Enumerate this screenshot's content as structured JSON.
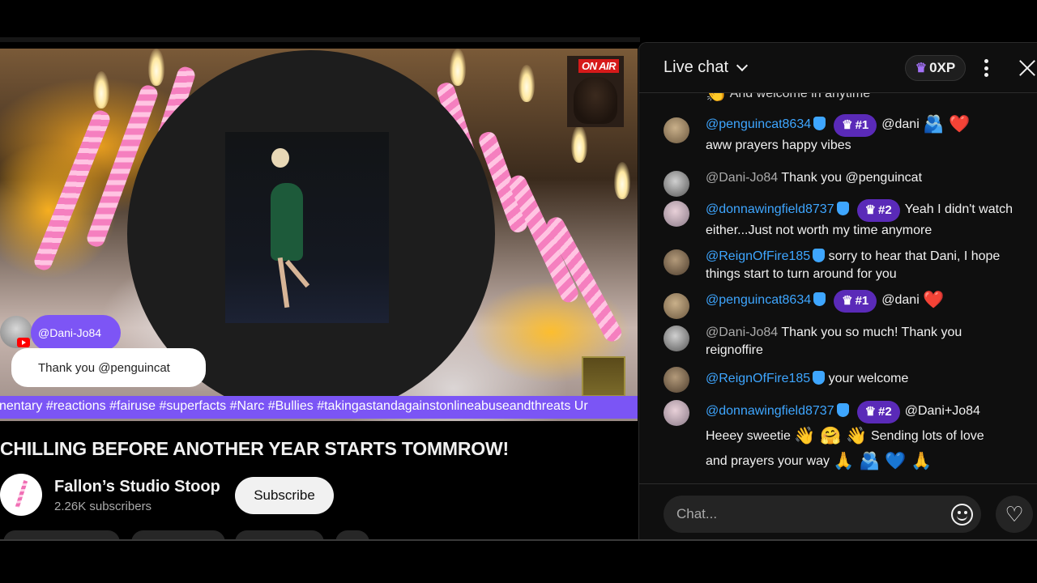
{
  "video": {
    "on_air_label": "ON AIR",
    "overlay_username": "@Dani-Jo84",
    "overlay_message": "Thank you @penguincat",
    "ticker_text": "nentary #reactions #fairuse #superfacts #Narc #Bullies #takingastandagainstonlineabuseandthreats Ur"
  },
  "page": {
    "title": "CHILLING BEFORE ANOTHER YEAR STARTS TOMMROW!"
  },
  "channel": {
    "name": "Fallon’s Studio Stoop",
    "subscribers": "2.26K subscribers",
    "subscribe_label": "Subscribe"
  },
  "chat": {
    "title": "Live chat",
    "xp_label": "0XP",
    "input_placeholder": "Chat...",
    "partial_top": "And welcome in anytime",
    "messages": [
      {
        "author": "@penguincat8634",
        "rank": "#1",
        "text": "@dani",
        "emoji_after": "🫂 ❤️",
        "text2": "aww prayers happy vibes"
      },
      {
        "author": "@Dani-Jo84",
        "text": "Thank you @penguincat"
      },
      {
        "author": "@donnawingfield8737",
        "rank": "#2",
        "text": "Yeah I didn't watch either...Just not worth my time anymore"
      },
      {
        "author": "@ReignOfFire185",
        "text": "sorry to hear that Dani, I hope things start to turn around for you"
      },
      {
        "author": "@penguincat8634",
        "rank": "#1",
        "text": "@dani",
        "emoji_after": "❤️"
      },
      {
        "author": "@Dani-Jo84",
        "text": "Thank you so much! Thank you reignoffire"
      },
      {
        "author": "@ReignOfFire185",
        "text": "your welcome"
      },
      {
        "author": "@donnawingfield8737",
        "rank": "#2",
        "text": "@Dani+Jo84",
        "text2a": "Heeey sweetie",
        "emoji_a": "👋 🤗 👋",
        "text2b": "Sending lots of love",
        "text3": "and prayers your way",
        "emoji_b": "🙏 🫂 💙 🙏"
      }
    ]
  },
  "icons": {
    "chevron": "chevron-down-icon",
    "crown": "crown-icon",
    "kebab": "more-vert-icon",
    "close": "close-icon",
    "verified": "verified-shield-icon",
    "emoji": "smiley-icon",
    "heart": "heart-icon"
  },
  "colors": {
    "accent_purple": "#7d55f5",
    "link_blue": "#3ea6ff",
    "rank_purple": "#5a2ab8",
    "youtube_red": "#ff0000"
  }
}
